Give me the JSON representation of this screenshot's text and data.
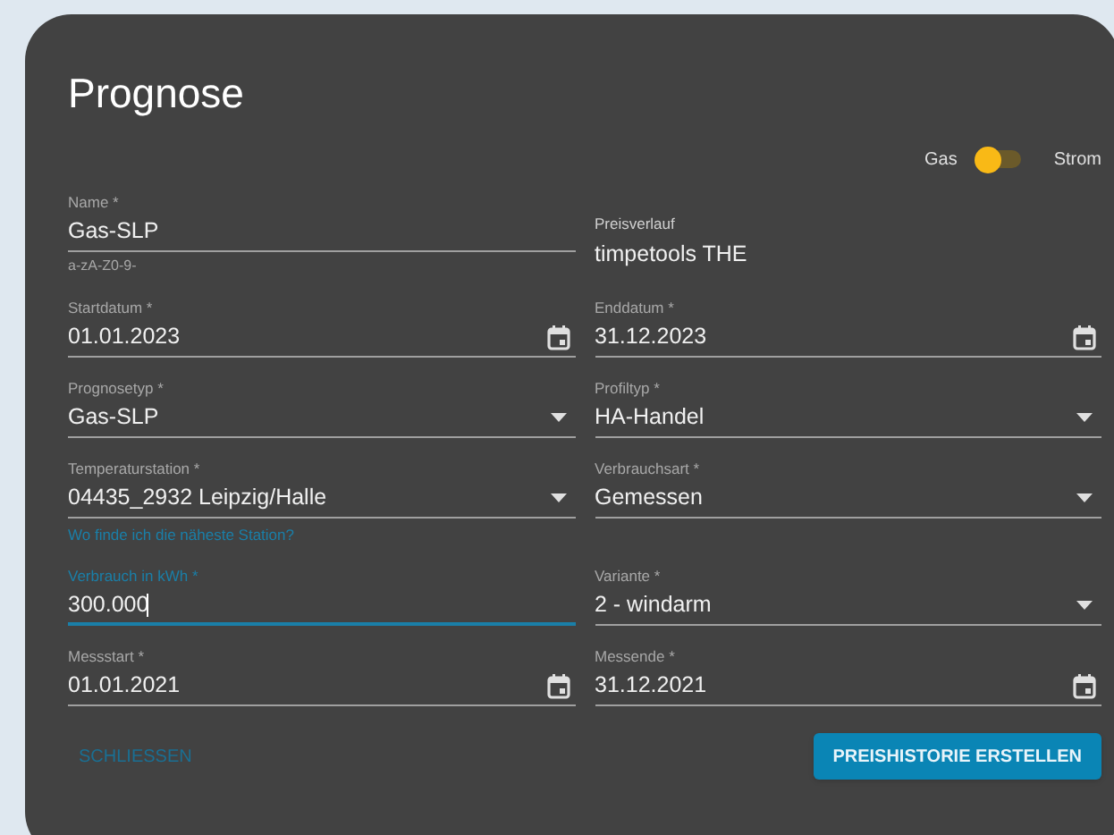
{
  "dialog": {
    "title": "Prognose",
    "switch": {
      "left_label": "Gas",
      "right_label": "Strom",
      "on": false
    },
    "fields": [
      {
        "kind": "text",
        "label": "Name *",
        "value": "Gas-SLP",
        "hint": "a-zA-Z0-9-",
        "focused": false
      },
      {
        "kind": "readonly",
        "label": "Preisverlauf",
        "value": "timpetools THE",
        "focused": false
      },
      {
        "kind": "date",
        "label": "Startdatum *",
        "value": "01.01.2023",
        "focused": false
      },
      {
        "kind": "date",
        "label": "Enddatum *",
        "value": "31.12.2023",
        "focused": false
      },
      {
        "kind": "select",
        "label": "Prognosetyp *",
        "value": "Gas-SLP",
        "focused": false
      },
      {
        "kind": "select",
        "label": "Profiltyp *",
        "value": "HA-Handel",
        "focused": false
      },
      {
        "kind": "select",
        "label": "Temperaturstation *",
        "value": "04435_2932 Leipzig/Halle",
        "link": "Wo finde ich die näheste Station?",
        "focused": false
      },
      {
        "kind": "select",
        "label": "Verbrauchsart *",
        "value": "Gemessen",
        "focused": false
      },
      {
        "kind": "text",
        "label": "Verbrauch in kWh *",
        "value": "300.000",
        "focused": true
      },
      {
        "kind": "select",
        "label": "Variante *",
        "value": "2 - windarm",
        "focused": false
      },
      {
        "kind": "date",
        "label": "Messstart *",
        "value": "01.01.2021",
        "focused": false
      },
      {
        "kind": "date",
        "label": "Messende *",
        "value": "31.12.2021",
        "focused": false
      }
    ],
    "buttons": [
      {
        "kind": "text",
        "label": "SCHLIESSEN"
      },
      {
        "kind": "filled",
        "label": "PREISHISTORIE ERSTELLEN"
      }
    ]
  }
}
